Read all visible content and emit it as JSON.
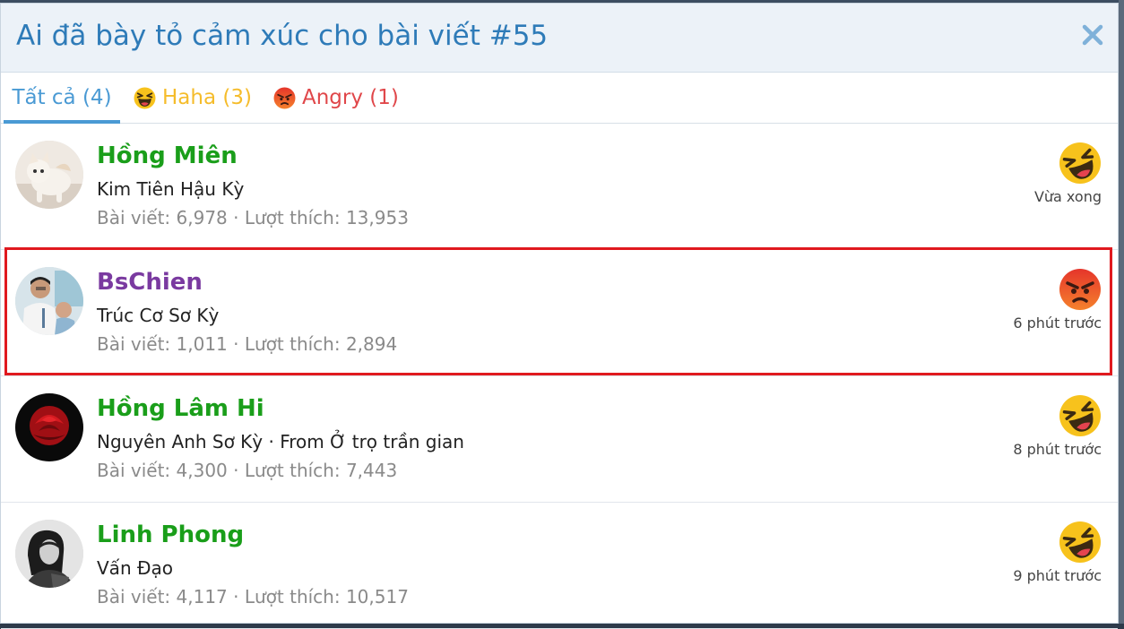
{
  "dialog": {
    "title": "Ai đã bày tỏ cảm xúc cho bài viết #55",
    "close_icon": "close-icon"
  },
  "tabs": [
    {
      "label": "Tất cả (4)",
      "active": true,
      "color": "#4a9ad4"
    },
    {
      "label": "Haha (3)",
      "icon": "haha-icon",
      "color": "#f5bc2b"
    },
    {
      "label": "Angry (1)",
      "icon": "angry-icon",
      "color": "#e0474a"
    }
  ],
  "rows": [
    {
      "username": "Hồng Miên",
      "name_color": "#1a9e1a",
      "title": "Kim Tiên Hậu Kỳ",
      "stats": "Bài viết: 6,978 · Lượt thích: 13,953",
      "reaction": "haha-icon",
      "time": "Vừa xong",
      "avatar": "cat-photo"
    },
    {
      "username": "BsChien",
      "name_color": "#7a3aa0",
      "title": "Trúc Cơ Sơ Kỳ",
      "stats": "Bài viết: 1,011 · Lượt thích: 2,894",
      "reaction": "angry-icon",
      "time": "6 phút trước",
      "avatar": "doctor-photo",
      "highlighted": true
    },
    {
      "username": "Hồng Lâm Hi",
      "name_color": "#1a9e1a",
      "title": "Nguyên Anh Sơ Kỳ · From Ở trọ trần gian",
      "stats": "Bài viết: 4,300 · Lượt thích: 7,443",
      "reaction": "haha-icon",
      "time": "8 phút trước",
      "avatar": "rose-photo"
    },
    {
      "username": "Linh Phong",
      "name_color": "#1a9e1a",
      "title": "Vấn Đạo",
      "stats": "Bài viết: 4,117 · Lượt thích: 10,517",
      "reaction": "haha-icon",
      "time": "9 phút trước",
      "avatar": "portrait-photo"
    }
  ],
  "colors": {
    "header_bg": "#ecf2f8",
    "title_blue": "#2e7bb8",
    "highlight_red": "#e0191e"
  }
}
